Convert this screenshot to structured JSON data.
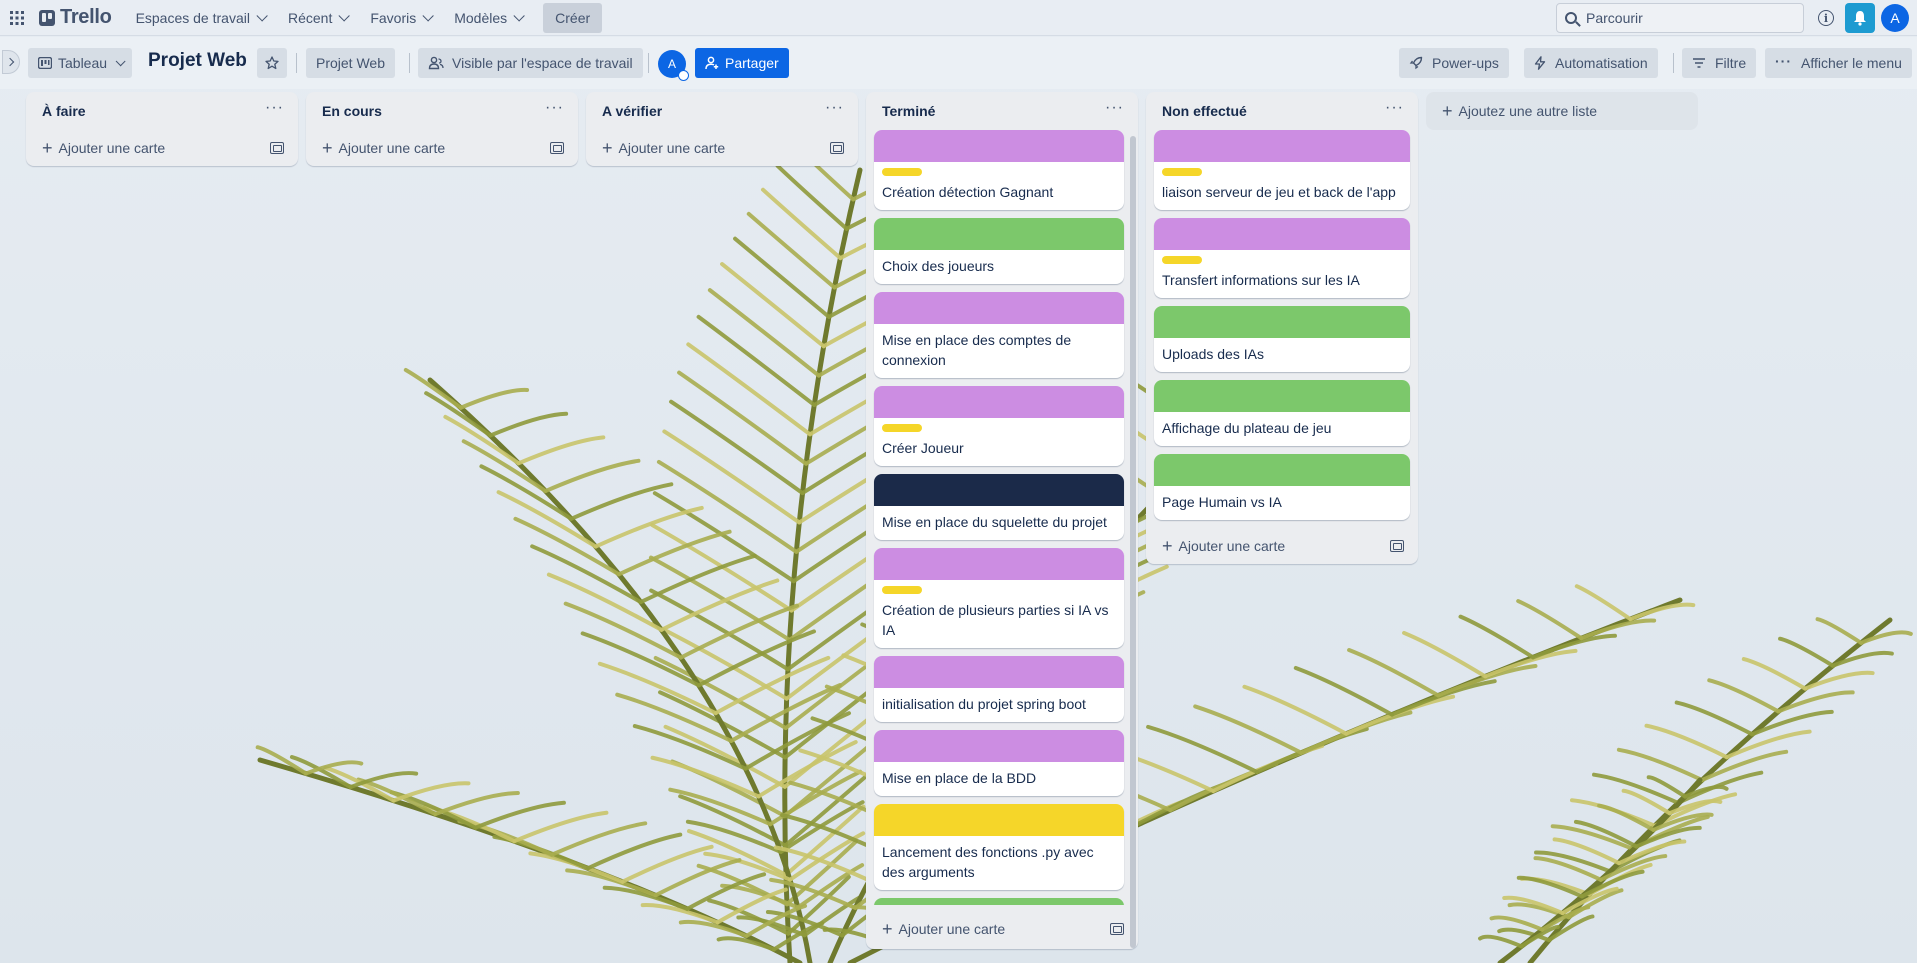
{
  "topbar": {
    "logo": "Trello",
    "nav": [
      {
        "label": "Espaces de travail"
      },
      {
        "label": "Récent"
      },
      {
        "label": "Favoris"
      },
      {
        "label": "Modèles"
      }
    ],
    "create": "Créer",
    "search_placeholder": "Parcourir",
    "avatar": "A",
    "colors": {
      "bell": "#1d9bd1",
      "avatar": "#0c66e4"
    }
  },
  "board": {
    "view": "Tableau",
    "title": "Projet Web",
    "workspace": "Projet Web",
    "visibility": "Visible par l'espace de travail",
    "member_avatar": "A",
    "share": "Partager",
    "powerups": "Power-ups",
    "automation": "Automatisation",
    "filter": "Filtre",
    "menu": "Afficher le menu"
  },
  "label_colors": {
    "purple": "#cc8de2",
    "green": "#7cc86b",
    "navy": "#1b2a49",
    "yellow": "#f5d629"
  },
  "lists": [
    {
      "title": "À faire",
      "add_card": "Ajouter une carte",
      "cards": []
    },
    {
      "title": "En cours",
      "add_card": "Ajouter une carte",
      "cards": []
    },
    {
      "title": "A vérifier",
      "add_card": "Ajouter une carte",
      "cards": []
    },
    {
      "title": "Terminé",
      "add_card": "Ajouter une carte",
      "cards": [
        {
          "cover": "purple",
          "label": "yellow",
          "title": "Création détection Gagnant"
        },
        {
          "cover": "green",
          "title": "Choix des joueurs"
        },
        {
          "cover": "purple",
          "title": "Mise en place des comptes de connexion"
        },
        {
          "cover": "purple",
          "label": "yellow",
          "title": "Créer Joueur"
        },
        {
          "cover": "navy",
          "title": "Mise en place du squelette du projet"
        },
        {
          "cover": "purple",
          "label": "yellow",
          "title": "Création de plusieurs parties si IA vs IA"
        },
        {
          "cover": "purple",
          "title": "initialisation du projet spring boot"
        },
        {
          "cover": "purple",
          "title": "Mise en place de la BDD"
        },
        {
          "cover": "yellow",
          "title": "Lancement des fonctions .py avec des arguments"
        },
        {
          "cover": "green",
          "title": ""
        }
      ]
    },
    {
      "title": "Non effectué",
      "add_card": "Ajouter une carte",
      "cards": [
        {
          "cover": "purple",
          "label": "yellow",
          "title": "liaison serveur de jeu et back de l'app"
        },
        {
          "cover": "purple",
          "label": "yellow",
          "title": "Transfert informations sur les IA"
        },
        {
          "cover": "green",
          "title": "Uploads des IAs"
        },
        {
          "cover": "green",
          "title": "Affichage du plateau de jeu"
        },
        {
          "cover": "green",
          "title": "Page Humain vs IA"
        }
      ]
    }
  ],
  "add_list": "Ajoutez une autre liste"
}
